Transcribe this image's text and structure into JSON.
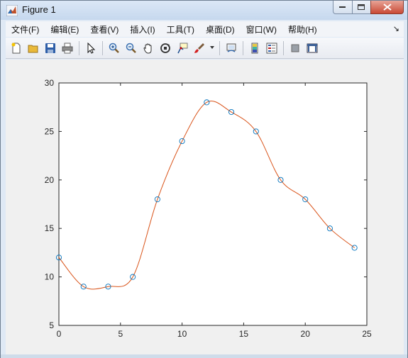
{
  "window": {
    "title": "Figure 1"
  },
  "menu": {
    "items": [
      {
        "label": "文件(F)"
      },
      {
        "label": "编辑(E)"
      },
      {
        "label": "查看(V)"
      },
      {
        "label": "插入(I)"
      },
      {
        "label": "工具(T)"
      },
      {
        "label": "桌面(D)"
      },
      {
        "label": "窗口(W)"
      },
      {
        "label": "帮助(H)"
      }
    ],
    "overflow_arrow": "↘"
  },
  "toolbar": {
    "icons": [
      "new-figure-icon",
      "open-file-icon",
      "save-icon",
      "print-icon",
      "edit-plot-arrow-icon",
      "zoom-in-icon",
      "zoom-out-icon",
      "pan-hand-icon",
      "rotate-3d-icon",
      "data-cursor-icon",
      "brush-icon",
      "brush-dropdown-icon",
      "link-plot-icon",
      "insert-colorbar-icon",
      "insert-legend-icon",
      "hide-plot-tools-icon",
      "show-plot-tools-icon"
    ]
  },
  "colors": {
    "marker": "#0072bd",
    "curve": "#d95319",
    "figure_bg": "#f0f0f0",
    "axes_bg": "#ffffff"
  },
  "chart_data": {
    "type": "line",
    "title": "",
    "xlabel": "",
    "ylabel": "",
    "xlim": [
      0,
      25
    ],
    "ylim": [
      5,
      30
    ],
    "xticks": [
      0,
      5,
      10,
      15,
      20,
      25
    ],
    "yticks": [
      5,
      10,
      15,
      20,
      25,
      30
    ],
    "grid": false,
    "series": [
      {
        "style": "markers-circle",
        "x": [
          0,
          2,
          4,
          6,
          8,
          10,
          12,
          14,
          16,
          18,
          20,
          22,
          24
        ],
        "y": [
          12,
          9,
          9,
          10,
          18,
          24,
          28,
          27,
          25,
          20,
          18,
          15,
          13
        ]
      },
      {
        "style": "smooth-curve",
        "x": [
          0,
          2,
          4,
          6,
          8,
          10,
          12,
          14,
          16,
          18,
          20,
          22,
          24
        ],
        "y": [
          12,
          9,
          9,
          10,
          18,
          24,
          28,
          27,
          25,
          20,
          18,
          15,
          13
        ]
      }
    ]
  }
}
